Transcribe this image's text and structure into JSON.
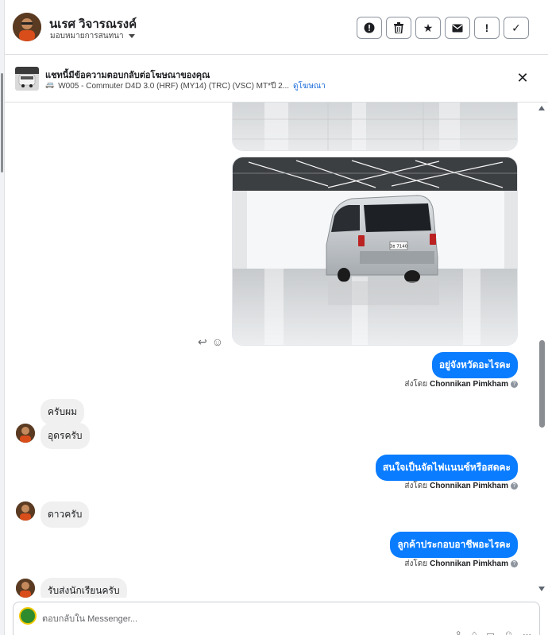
{
  "header": {
    "contact_name": "นเรศ วิจารณรงค์",
    "assign_label": "มอบหมายการสนทนา",
    "actions": [
      {
        "icon": "alert-circle-icon",
        "glyph": "!"
      },
      {
        "icon": "trash-icon",
        "glyph": "🗑"
      },
      {
        "icon": "star-icon",
        "glyph": "★"
      },
      {
        "icon": "envelope-icon",
        "glyph": "✉"
      },
      {
        "icon": "exclamation-icon",
        "glyph": "!"
      },
      {
        "icon": "check-icon",
        "glyph": "✓"
      }
    ]
  },
  "ad_banner": {
    "title": "แชทนี้มีข้อความตอบกลับต่อโฆษณาของคุณ",
    "product_icon": "🚐",
    "product": "W005 - Commuter D4D 3.0 (HRF) (MY14) (TRC) (VSC) MT*ปี 2...",
    "view_ad_link": "ดูโฆษณา",
    "close_glyph": "✕"
  },
  "messages": {
    "reaction_icons": [
      "↩",
      "☺"
    ],
    "plate": "3ฮ 7140",
    "out_1": "อยู่จังหวัดอะไรคะ",
    "in_1": "ครับผม",
    "in_2": "อุดรครับ",
    "out_2": "สนใจเป็นจัดไฟแนนซ์หรือสดคะ",
    "in_3": "ดาวครับ",
    "out_3": "ลูกค้าประกอบอาชีพอะไรคะ",
    "in_4": "รับส่งนักเรียนครับ",
    "sent_by_prefix": "ส่งโดย",
    "sent_by_name": "Chonnikan Pimkham",
    "info_glyph": "?"
  },
  "composer": {
    "placeholder": "ตอบกลับใน Messenger..."
  }
}
